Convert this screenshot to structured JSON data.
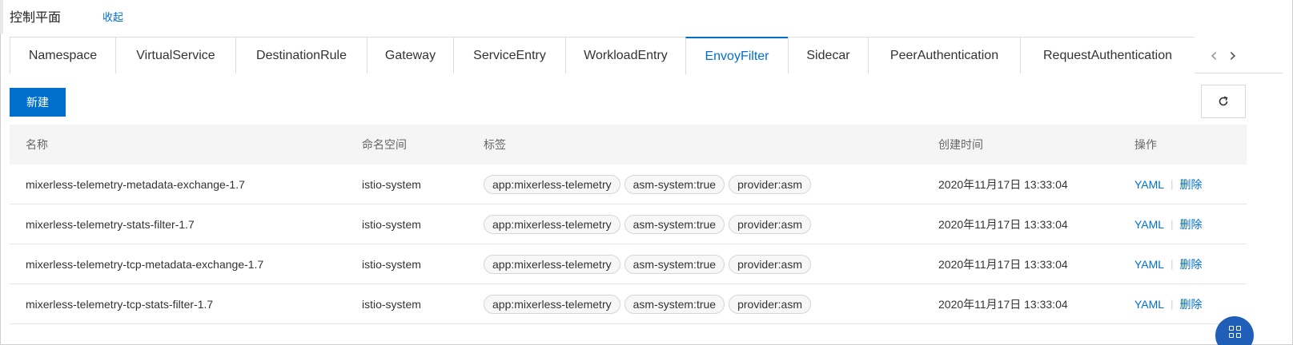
{
  "header": {
    "title": "控制平面",
    "collapse_label": "收起"
  },
  "tabs": [
    {
      "label": "Namespace",
      "active": false
    },
    {
      "label": "VirtualService",
      "active": false
    },
    {
      "label": "DestinationRule",
      "active": false
    },
    {
      "label": "Gateway",
      "active": false
    },
    {
      "label": "ServiceEntry",
      "active": false
    },
    {
      "label": "WorkloadEntry",
      "active": false
    },
    {
      "label": "EnvoyFilter",
      "active": true
    },
    {
      "label": "Sidecar",
      "active": false
    },
    {
      "label": "PeerAuthentication",
      "active": false
    },
    {
      "label": "RequestAuthentication",
      "active": false
    }
  ],
  "toolbar": {
    "new_label": "新建",
    "refresh_icon": "refresh-icon"
  },
  "table": {
    "columns": [
      "名称",
      "命名空间",
      "标签",
      "创建时间",
      "操作"
    ],
    "rows": [
      {
        "name": "mixerless-telemetry-metadata-exchange-1.7",
        "namespace": "istio-system",
        "tags": [
          "app:mixerless-telemetry",
          "asm-system:true",
          "provider:asm"
        ],
        "created": "2020年11月17日 13:33:04",
        "actions": [
          "YAML",
          "删除"
        ]
      },
      {
        "name": "mixerless-telemetry-stats-filter-1.7",
        "namespace": "istio-system",
        "tags": [
          "app:mixerless-telemetry",
          "asm-system:true",
          "provider:asm"
        ],
        "created": "2020年11月17日 13:33:04",
        "actions": [
          "YAML",
          "删除"
        ]
      },
      {
        "name": "mixerless-telemetry-tcp-metadata-exchange-1.7",
        "namespace": "istio-system",
        "tags": [
          "app:mixerless-telemetry",
          "asm-system:true",
          "provider:asm"
        ],
        "created": "2020年11月17日 13:33:04",
        "actions": [
          "YAML",
          "删除"
        ]
      },
      {
        "name": "mixerless-telemetry-tcp-stats-filter-1.7",
        "namespace": "istio-system",
        "tags": [
          "app:mixerless-telemetry",
          "asm-system:true",
          "provider:asm"
        ],
        "created": "2020年11月17日 13:33:04",
        "actions": [
          "YAML",
          "删除"
        ]
      }
    ]
  },
  "colors": {
    "accent": "#0070cc",
    "float_button": "#1f5fb8"
  }
}
